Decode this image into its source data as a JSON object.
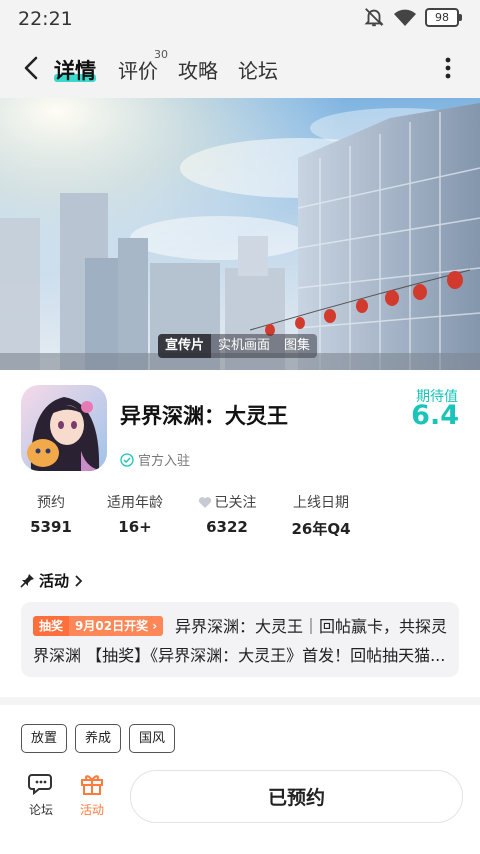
{
  "status_bar": {
    "time": "22:21",
    "battery": "98"
  },
  "nav": {
    "tabs": [
      {
        "label": "详情",
        "active": true
      },
      {
        "label": "评价",
        "count": "30"
      },
      {
        "label": "攻略"
      },
      {
        "label": "论坛"
      }
    ]
  },
  "banner": {
    "media_tabs": [
      "宣传片",
      "实机画面",
      "图集"
    ]
  },
  "game": {
    "title": "异界深渊：大灵王",
    "official": "官方入驻",
    "score_label": "期待值",
    "score": "6.4"
  },
  "stats": [
    {
      "label": "预约",
      "value": "5391"
    },
    {
      "label": "适用年龄",
      "value": "16+"
    },
    {
      "label": "已关注",
      "value": "6322"
    },
    {
      "label": "上线日期",
      "value": "26年Q4"
    }
  ],
  "activity": {
    "title": "活动",
    "badge_type": "抽奖",
    "badge_date": "9月02日开奖",
    "line1": "异界深渊：大灵王｜回帖赢卡，共探灵",
    "line2": "界深渊 【抽奖】《异界深渊：大灵王》首发！回帖抽天猫..."
  },
  "tags": [
    "放置",
    "养成",
    "国风"
  ],
  "bottom": {
    "forum_label": "论坛",
    "activity_label": "活动",
    "reserve_label": "已预约"
  },
  "colors": {
    "accent": "#19c4b8",
    "promo": "#ff6f3c",
    "activity_icon": "#ff7a3d"
  }
}
